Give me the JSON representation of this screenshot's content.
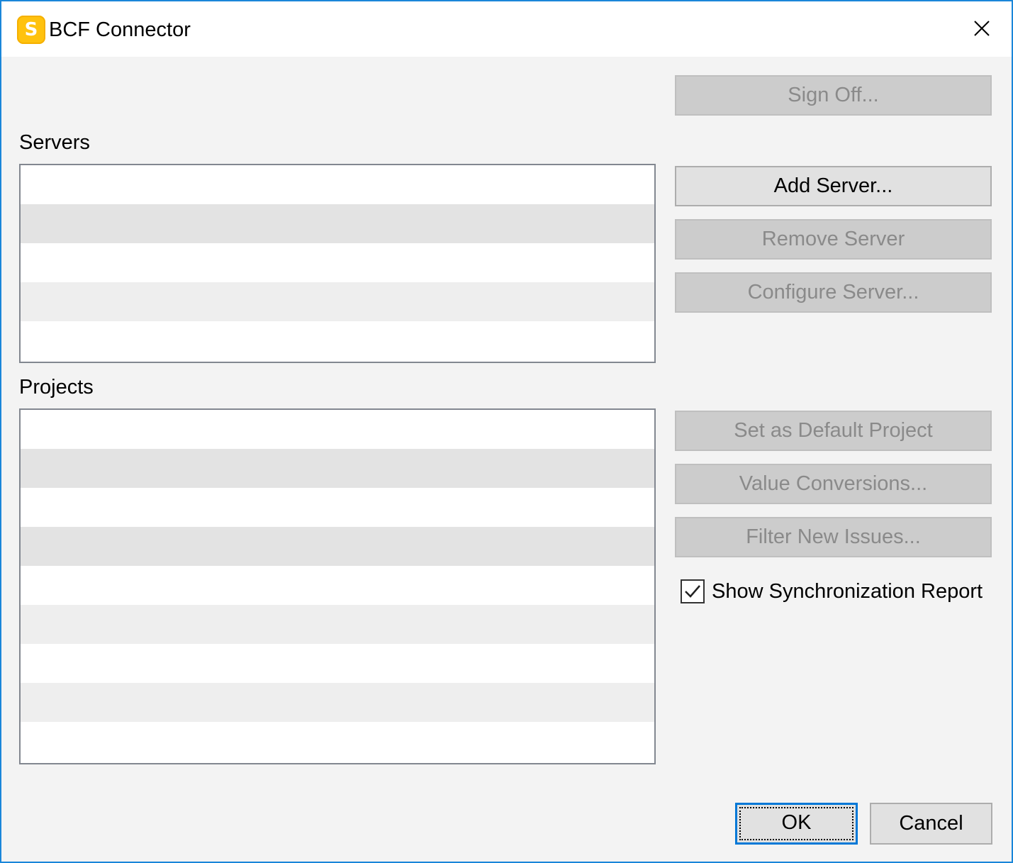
{
  "window": {
    "title": "BCF Connector",
    "app_icon_letter": "S",
    "accent_color": "#0078d7",
    "icon_color": "#ffc20e"
  },
  "title_bar": {
    "close_icon": "close-icon"
  },
  "buttons": {
    "sign_off": "Sign Off...",
    "add_server": "Add Server...",
    "remove_server": "Remove Server",
    "configure_server": "Configure Server...",
    "set_default_project": "Set as Default Project",
    "value_conversions": "Value Conversions...",
    "filter_new_issues": "Filter New Issues...",
    "ok": "OK",
    "cancel": "Cancel"
  },
  "servers": {
    "label": "Servers",
    "items": []
  },
  "projects": {
    "label": "Projects",
    "items": []
  },
  "options": {
    "show_sync_report": {
      "label": "Show Synchronization Report",
      "checked": true
    }
  }
}
